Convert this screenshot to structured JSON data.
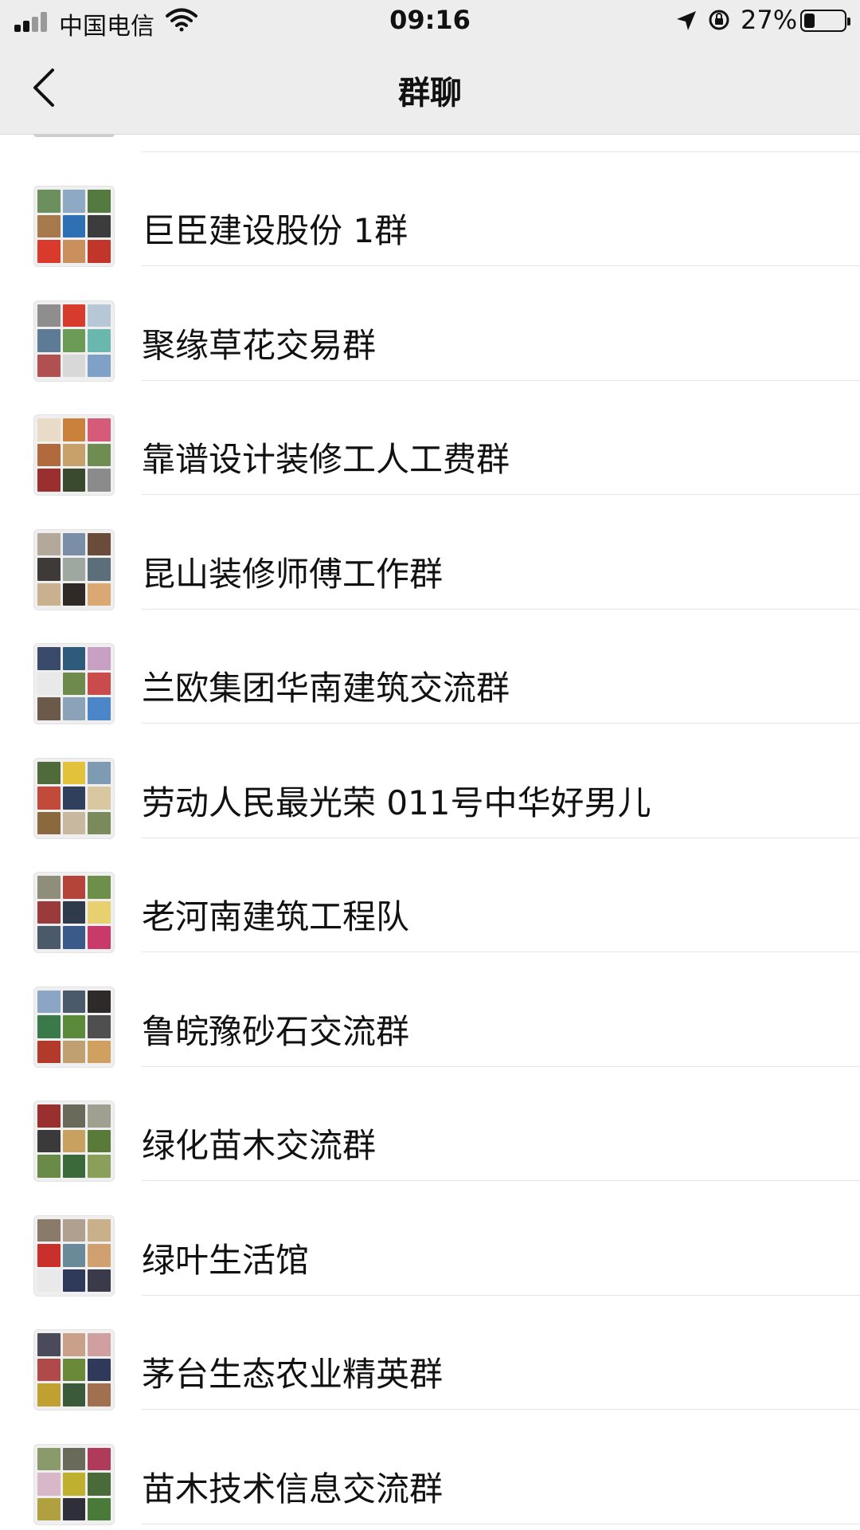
{
  "status_bar": {
    "carrier": "中国电信",
    "time": "09:16",
    "battery_percent": "27%",
    "battery_level": 0.27,
    "icons": [
      "signal-icon",
      "wifi-icon",
      "location-arrow-icon",
      "orientation-lock-icon",
      "battery-icon"
    ]
  },
  "nav": {
    "title": "群聊",
    "back_icon": "chevron-left-icon"
  },
  "groups": [
    {
      "name": "巨臣建设股份 1群",
      "colors": [
        "#6b8f5e",
        "#8da9c4",
        "#557a3f",
        "#a77a4e",
        "#2f6fb3",
        "#3c3c3c",
        "#d93a2b",
        "#c98f5c",
        "#c1352b"
      ]
    },
    {
      "name": "聚缘草花交易群",
      "colors": [
        "#8e8e8e",
        "#d63b2d",
        "#b7c7d6",
        "#5d7b94",
        "#6c9a57",
        "#6ab7b0",
        "#b05050",
        "#d8d8d8",
        "#7fa1c7"
      ]
    },
    {
      "name": "靠谱设计装修工人工费群",
      "colors": [
        "#e8dcc8",
        "#c9813c",
        "#d65a7a",
        "#b06a3e",
        "#c7a06a",
        "#6f8d52",
        "#9a2f2f",
        "#3b4a2e",
        "#8b8b8b"
      ]
    },
    {
      "name": "昆山装修师傅工作群",
      "colors": [
        "#b4a89a",
        "#7a8ea8",
        "#6b4b3a",
        "#3e3a37",
        "#9fa8a0",
        "#5c6e7a",
        "#c9b08f",
        "#2f2a26",
        "#d9a873"
      ]
    },
    {
      "name": "兰欧集团华南建筑交流群",
      "colors": [
        "#3a4a6a",
        "#2f5a7a",
        "#c7a0c4",
        "#e9e9e9",
        "#6f8a4d",
        "#c94b4b",
        "#6b5a4a",
        "#8aa3b8",
        "#4a86c8"
      ]
    },
    {
      "name": "劳动人民最光荣 011号中华好男儿",
      "colors": [
        "#4f6b3c",
        "#e2c23a",
        "#7f9bb4",
        "#c24a3a",
        "#2f3f5c",
        "#d8c7a0",
        "#8a6a3c",
        "#c8b8a0",
        "#7a8a5a"
      ]
    },
    {
      "name": "老河南建筑工程队",
      "colors": [
        "#8e8e7a",
        "#b5433a",
        "#6e8f4a",
        "#9a3a3a",
        "#2f3a4a",
        "#e8d070",
        "#4a5a6a",
        "#3a5a8a",
        "#c83a6a"
      ]
    },
    {
      "name": "鲁皖豫砂石交流群",
      "colors": [
        "#8aa6c4",
        "#4a5a6a",
        "#2f2a2a",
        "#3a7a4a",
        "#5a8a3a",
        "#4f4f4f",
        "#b23a2a",
        "#c0a070",
        "#d0a060"
      ]
    },
    {
      "name": "绿化苗木交流群",
      "colors": [
        "#9a2f2f",
        "#6a6a5a",
        "#a0a090",
        "#3a3a3a",
        "#c8a060",
        "#5a7a3a",
        "#6a8a4a",
        "#3a6a3a",
        "#8aa05a"
      ]
    },
    {
      "name": "绿叶生活馆",
      "colors": [
        "#8a7a6a",
        "#b0a090",
        "#c9b08a",
        "#c9302c",
        "#6a8a9a",
        "#d0a070",
        "#e9e9e9",
        "#2f3a5a",
        "#3a3a4a"
      ]
    },
    {
      "name": "茅台生态农业精英群",
      "colors": [
        "#4a4a5a",
        "#c9a08a",
        "#d0a0a0",
        "#b04a4a",
        "#6a8a3a",
        "#2f3a5a",
        "#c0a030",
        "#3a5a3a",
        "#a07050"
      ]
    },
    {
      "name": "苗木技术信息交流群",
      "colors": [
        "#8a9a6a",
        "#6a6a5a",
        "#b03a5a",
        "#d8b8c8",
        "#c0b030",
        "#4a6a3a",
        "#b0a040",
        "#2f2f3a",
        "#4a7a3a"
      ]
    }
  ]
}
